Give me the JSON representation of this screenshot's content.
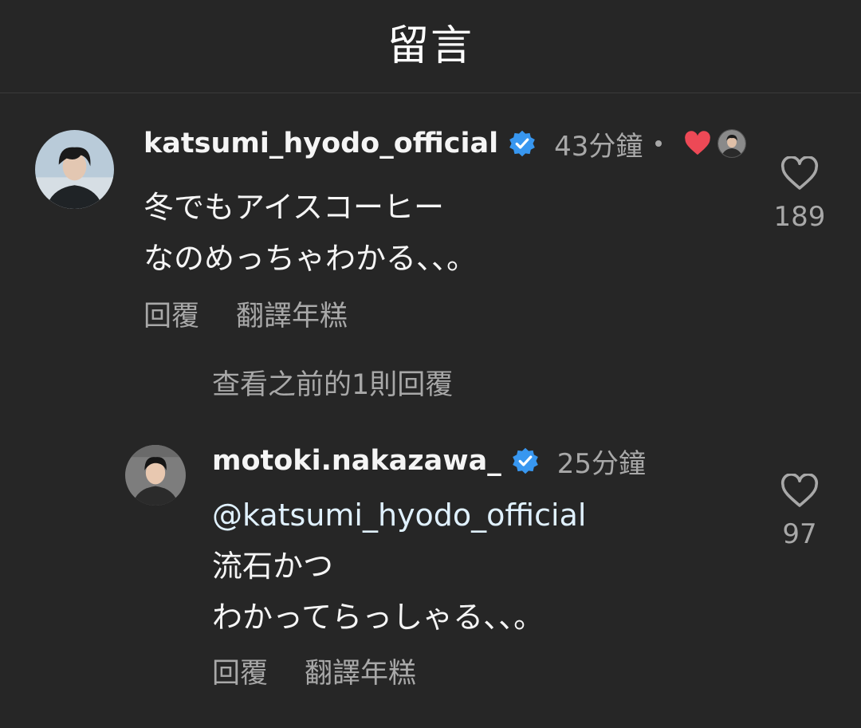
{
  "header": {
    "title": "留言"
  },
  "comments": [
    {
      "username": "katsumi_hyodo_official",
      "time": "43分鐘",
      "lines": [
        "冬でもアイスコーヒー",
        "なのめっちゃわかる、、。"
      ],
      "reply_label": "回覆",
      "translate_label": "翻譯年糕",
      "likes": "189",
      "creator_liked": true
    }
  ],
  "view_replies": "查看之前的1則回覆",
  "replies": [
    {
      "username": "motoki.nakazawa_",
      "time": "25分鐘",
      "mention": "@katsumi_hyodo_official",
      "lines": [
        "流石かつ",
        "わかってらっしゃる、、。"
      ],
      "reply_label": "回覆",
      "translate_label": "翻譯年糕",
      "likes": "97"
    }
  ],
  "colors": {
    "background": "#262626",
    "verified": "#3897f0",
    "heart": "#ed4956",
    "secondary_text": "#a8a8a8"
  }
}
